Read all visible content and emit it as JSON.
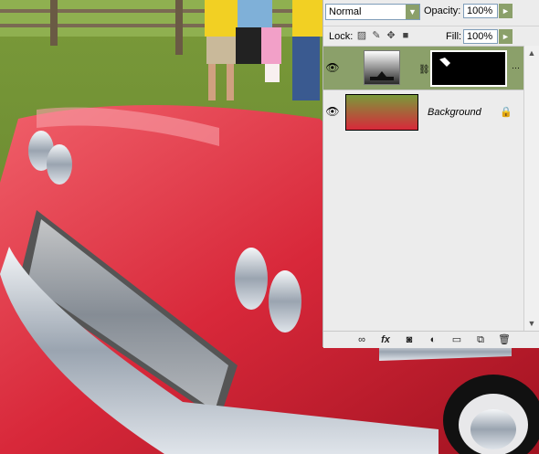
{
  "panel": {
    "blend_mode": "Normal",
    "opacity_label": "Opacity:",
    "opacity_value": "100%",
    "lock_label": "Lock:",
    "fill_label": "Fill:",
    "fill_value": "100%",
    "layers": [
      {
        "name": "",
        "selected": true,
        "visible": true
      },
      {
        "name": "Background",
        "selected": false,
        "visible": true,
        "locked": true
      }
    ],
    "bottom_icons": [
      "link-icon",
      "fx-icon",
      "mask-icon",
      "adjustment-icon",
      "folder-icon",
      "new-layer-icon",
      "trash-icon"
    ],
    "fx_label": "fx",
    "accent_color": "#8ba06a"
  }
}
